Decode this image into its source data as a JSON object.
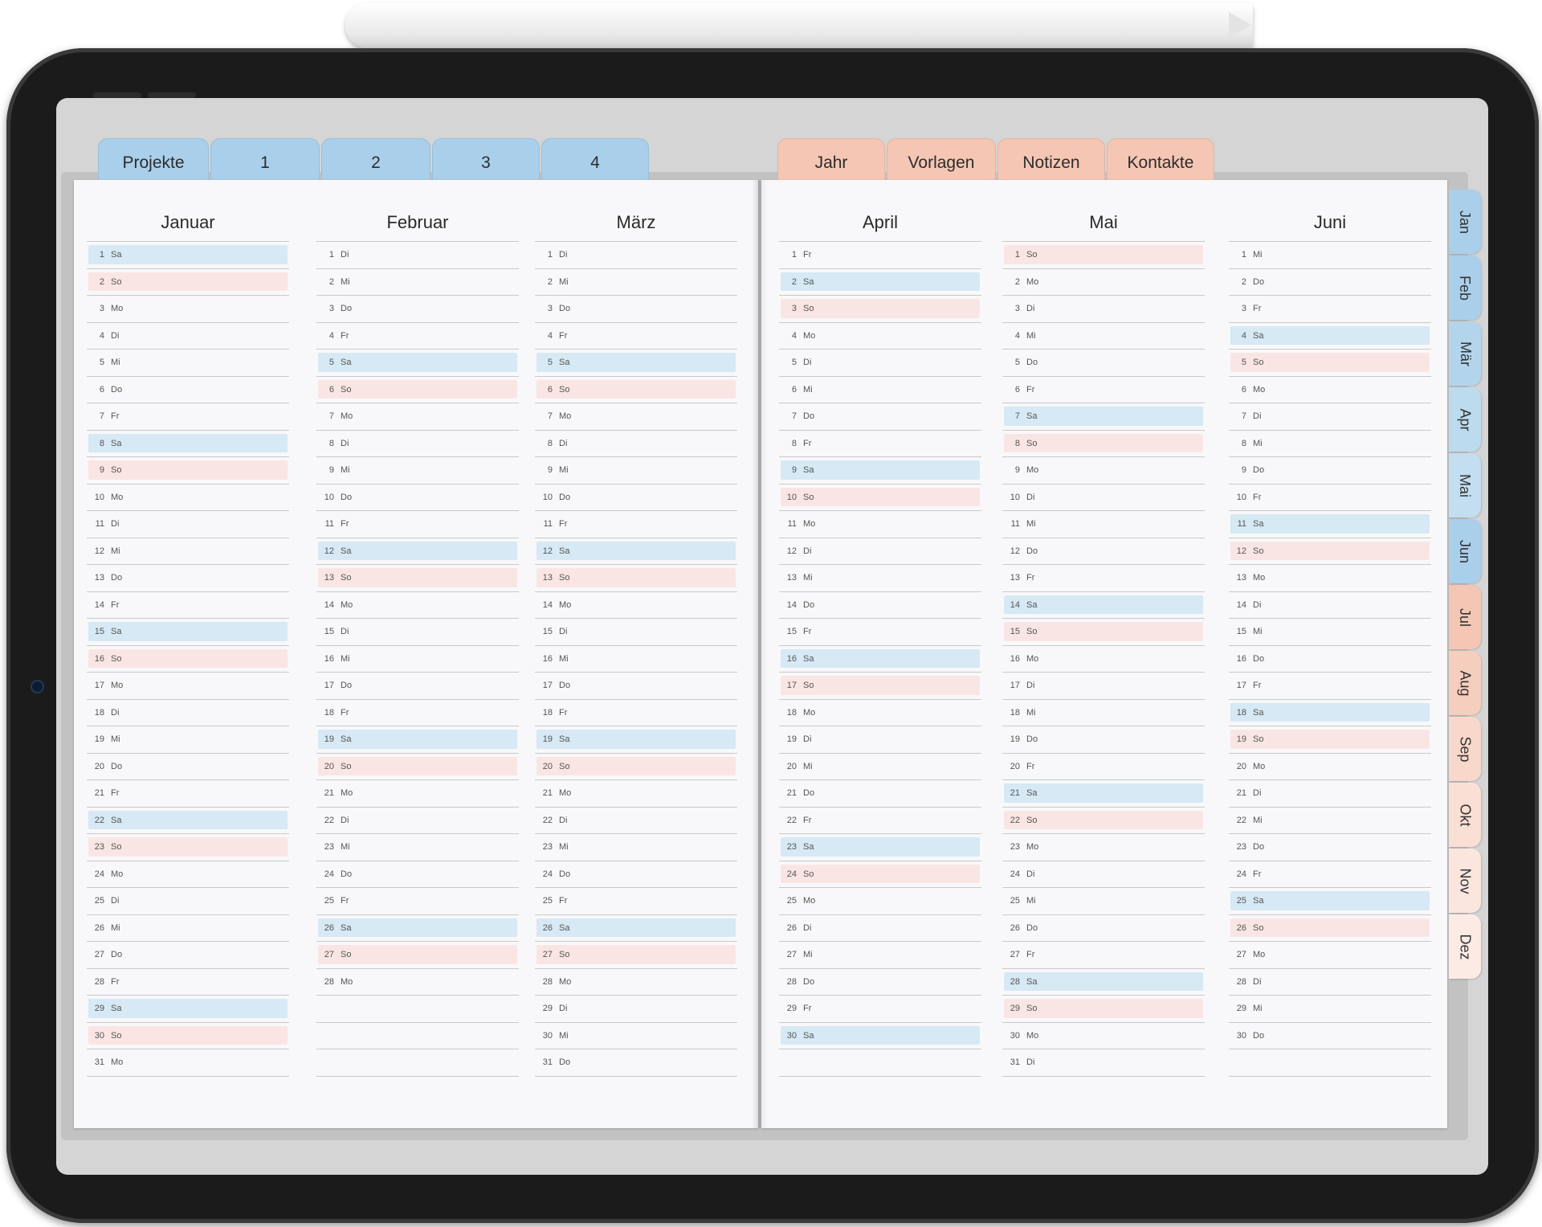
{
  "top_tabs": {
    "left": [
      "Projekte",
      "1",
      "2",
      "3",
      "4"
    ],
    "right": [
      "Jahr",
      "Vorlagen",
      "Notizen",
      "Kontakte"
    ]
  },
  "side_tabs": [
    "Jan",
    "Feb",
    "Mär",
    "Apr",
    "Mai",
    "Jun",
    "Jul",
    "Aug",
    "Sep",
    "Okt",
    "Nov",
    "Dez"
  ],
  "colors": {
    "blue_tab": "#a9cfea",
    "peach_tab": "#f4c6b3",
    "saturday_highlight": "#d6e9f4",
    "sunday_highlight": "#fae5e5"
  },
  "months": [
    {
      "name": "Januar",
      "first_weekday": "Sa",
      "days": 31
    },
    {
      "name": "Februar",
      "first_weekday": "Di",
      "days": 28
    },
    {
      "name": "März",
      "first_weekday": "Di",
      "days": 31
    },
    {
      "name": "April",
      "first_weekday": "Fr",
      "days": 30
    },
    {
      "name": "Mai",
      "first_weekday": "So",
      "days": 31
    },
    {
      "name": "Juni",
      "first_weekday": "Mi",
      "days": 30
    }
  ],
  "weekdays": [
    "Mo",
    "Di",
    "Mi",
    "Do",
    "Fr",
    "Sa",
    "So"
  ]
}
